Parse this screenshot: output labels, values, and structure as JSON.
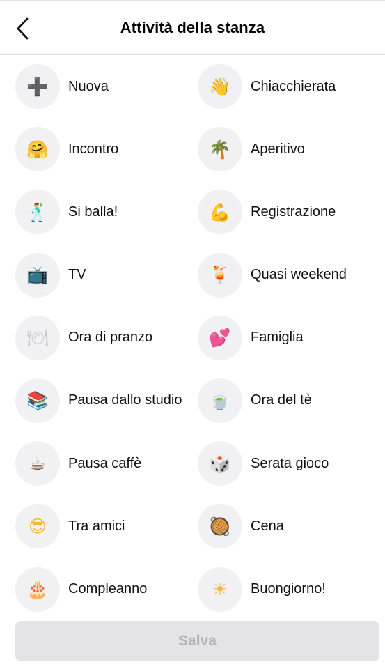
{
  "header": {
    "title": "Attività della stanza"
  },
  "activities": [
    {
      "label": "Nuova",
      "icon": "plus-icon",
      "glyph": "➕",
      "color": "#8a96a8"
    },
    {
      "label": "Chiacchierata",
      "icon": "waving-hand-icon",
      "glyph": "👋",
      "color": "#f4b73c"
    },
    {
      "label": "Incontro",
      "icon": "hugging-face-icon",
      "glyph": "🤗",
      "color": "#f4b73c"
    },
    {
      "label": "Aperitivo",
      "icon": "palm-tree-icon",
      "glyph": "🌴",
      "color": "#5aa34a"
    },
    {
      "label": "Si balla!",
      "icon": "dancing-person-icon",
      "glyph": "🕺",
      "color": "#4a4a4a"
    },
    {
      "label": "Registrazione",
      "icon": "flexed-biceps-icon",
      "glyph": "💪",
      "color": "#f4b73c"
    },
    {
      "label": "TV",
      "icon": "television-icon",
      "glyph": "📺",
      "color": "#3c3c3c"
    },
    {
      "label": "Quasi weekend",
      "icon": "tropical-drink-icon",
      "glyph": "🍹",
      "color": "#f08a30"
    },
    {
      "label": "Ora di pranzo",
      "icon": "fork-knife-plate-icon",
      "glyph": "🍽",
      "color": "#c8c8c8"
    },
    {
      "label": "Famiglia",
      "icon": "two-hearts-icon",
      "glyph": "💕",
      "color": "#e0345a"
    },
    {
      "label": "Pausa dallo studio",
      "icon": "books-icon",
      "glyph": "📚",
      "color": "#7a6a55"
    },
    {
      "label": "Ora del tè",
      "icon": "tea-bowl-icon",
      "glyph": "🍵",
      "color": "#3d5a3a"
    },
    {
      "label": "Pausa caffè",
      "icon": "coffee-cup-icon",
      "glyph": "☕",
      "color": "#7a5030"
    },
    {
      "label": "Serata gioco",
      "icon": "dice-icon",
      "glyph": "🎲",
      "color": "#d2283a"
    },
    {
      "label": "Tra amici",
      "icon": "sunglasses-face-icon",
      "glyph": "😎",
      "color": "#f4b73c"
    },
    {
      "label": "Cena",
      "icon": "paella-pan-icon",
      "glyph": "🥘",
      "color": "#e0902a"
    },
    {
      "label": "Compleanno",
      "icon": "birthday-cake-icon",
      "glyph": "🎂",
      "color": "#f2a9c4"
    },
    {
      "label": "Buongiorno!",
      "icon": "sun-icon",
      "glyph": "☀",
      "color": "#f4b73c"
    }
  ],
  "footer": {
    "save_label": "Salva"
  }
}
